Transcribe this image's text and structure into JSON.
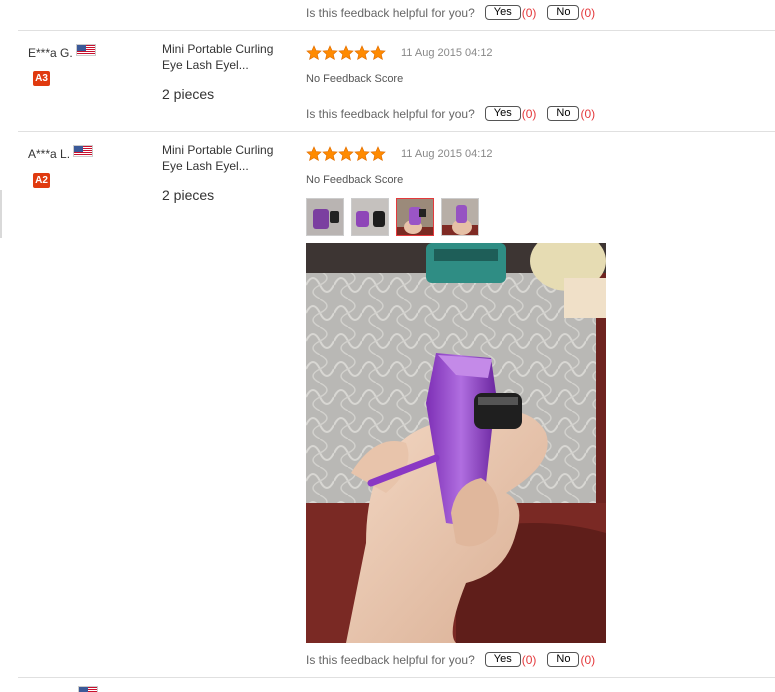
{
  "helpful_question": "Is this feedback helpful for you?",
  "yes_label": "Yes",
  "no_label": "No",
  "top": {
    "yes_count": "(0)",
    "no_count": "(0)"
  },
  "reviews": [
    {
      "user": "E***a G.",
      "badge": "A3",
      "product_line1": "Mini Portable Curling",
      "product_line2": "Eye Lash Eyel...",
      "qty": "2 pieces",
      "rating": 5,
      "date": "11 Aug 2015 04:12",
      "feedback_score": "No Feedback Score",
      "yes_count": "(0)",
      "no_count": "(0)"
    },
    {
      "user": "A***a L.",
      "badge": "A2",
      "product_line1": "Mini Portable Curling",
      "product_line2": "Eye Lash Eyel...",
      "qty": "2 pieces",
      "rating": 5,
      "date": "11 Aug 2015 04:12",
      "feedback_score": "No Feedback Score",
      "yes_count": "(0)",
      "no_count": "(0)"
    }
  ],
  "colors": {
    "accent": "#e4393c",
    "star": "#ff8a00",
    "badge": "#e03a0f"
  },
  "icons": {
    "star": "star-icon",
    "flag": "us-flag-icon"
  }
}
